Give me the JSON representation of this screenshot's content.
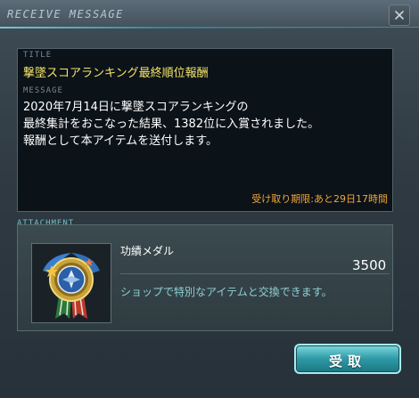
{
  "window": {
    "title": "RECEIVE MESSAGE"
  },
  "message": {
    "title_label": "TITLE",
    "title": "撃墜スコアランキング最終順位報酬",
    "message_label": "MESSAGE",
    "body_lines": [
      "2020年7月14日に撃墜スコアランキングの",
      "最終集計をおこなった結果、1382位に入賞されました。",
      "報酬として本アイテムを送付します。"
    ],
    "deadline": "受け取り期限:あと29日17時間"
  },
  "attachment": {
    "label": "ATTACHMENT",
    "item_name": "功績メダル",
    "item_count": "3500",
    "item_description": "ショップで特別なアイテムと交換できます。",
    "icon": "medal-icon"
  },
  "actions": {
    "receive_label": "受取"
  },
  "colors": {
    "title_yellow": "#f7e56a",
    "deadline_orange": "#f0a43a",
    "accent_teal": "#2d9aa6",
    "description_cyan": "#8fd0d6"
  }
}
